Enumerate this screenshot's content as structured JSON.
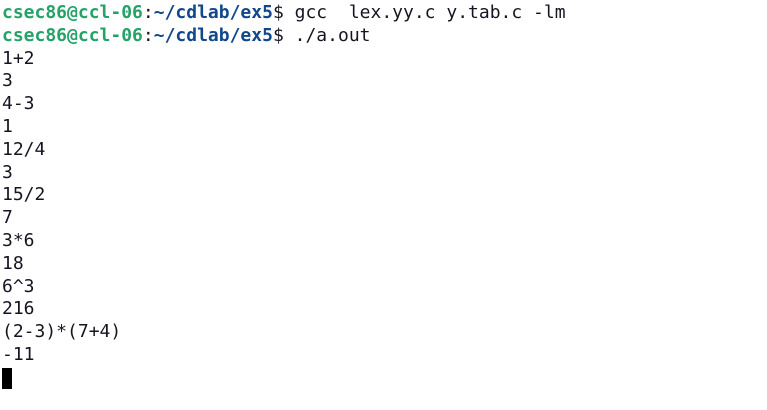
{
  "terminal": {
    "prompts": [
      {
        "user_host": "csec86@ccl-06",
        "sep": ":",
        "path": "~/cdlab/ex5",
        "symbol": "$",
        "command": " gcc  lex.yy.c y.tab.c -lm"
      },
      {
        "user_host": "csec86@ccl-06",
        "sep": ":",
        "path": "~/cdlab/ex5",
        "symbol": "$",
        "command": " ./a.out"
      }
    ],
    "output": [
      "1+2",
      "3",
      "4-3",
      "1",
      "12/4",
      "3",
      "15/2",
      "7",
      "3*6",
      "18",
      "6^3",
      "216",
      "(2-3)*(7+4)",
      "-11"
    ],
    "colors": {
      "background": "#ffffff",
      "text": "#171421",
      "user_host": "#26a269",
      "path": "#12488b",
      "cursor": "#000000"
    }
  }
}
